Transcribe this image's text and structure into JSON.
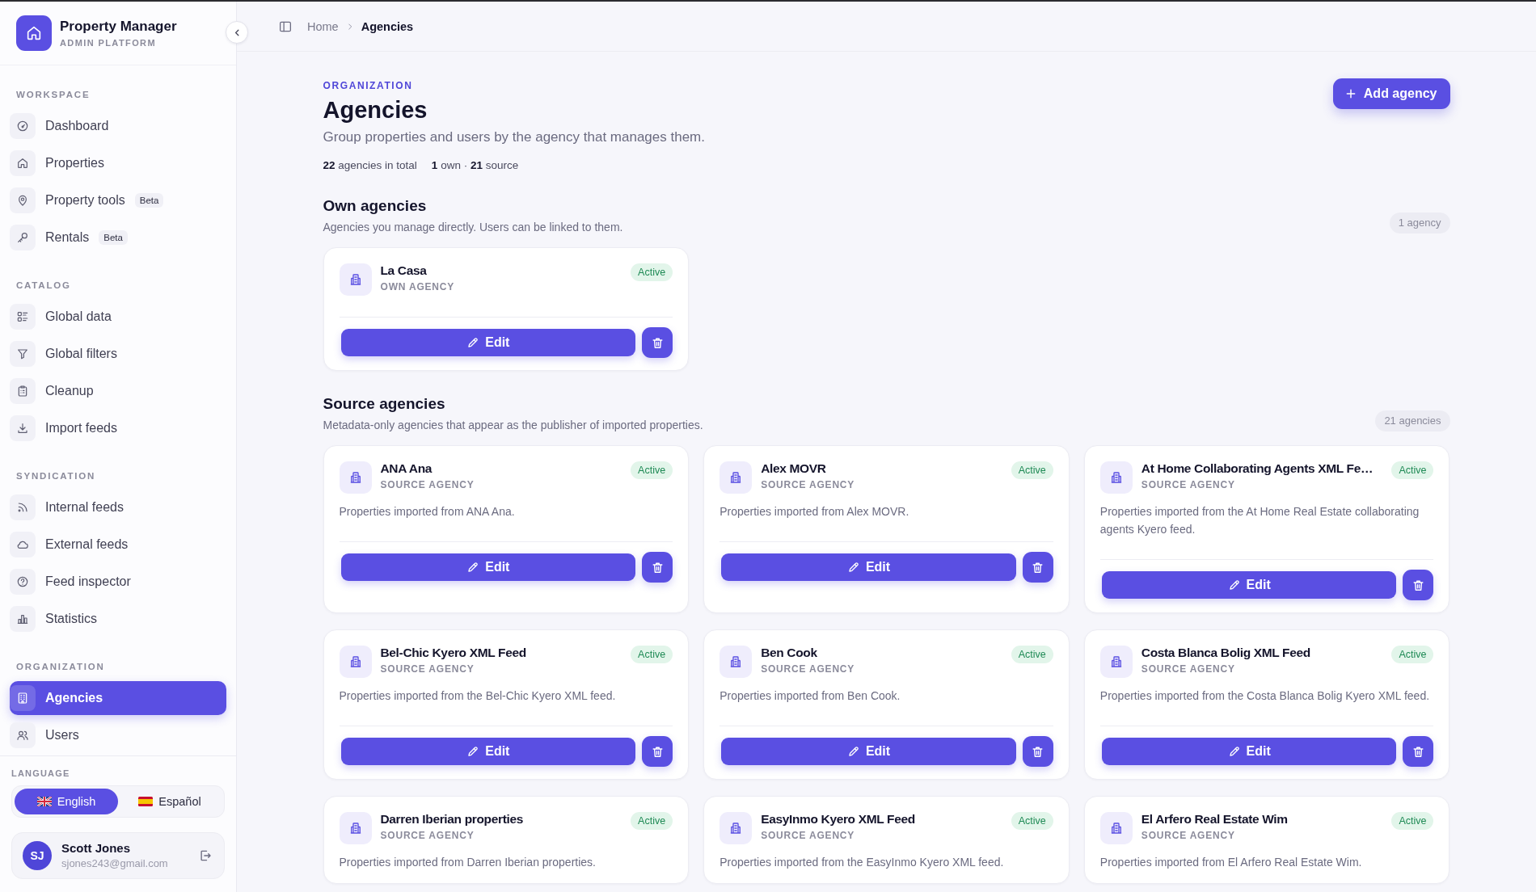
{
  "sidebar": {
    "brand": {
      "title": "Property Manager",
      "subtitle": "ADMIN PLATFORM"
    },
    "sections": [
      {
        "label": "WORKSPACE",
        "items": [
          {
            "label": "Dashboard",
            "selected": false
          },
          {
            "label": "Properties",
            "selected": false
          },
          {
            "label": "Property tools",
            "badge": "Beta",
            "selected": false
          },
          {
            "label": "Rentals",
            "badge": "Beta",
            "selected": false
          }
        ]
      },
      {
        "label": "CATALOG",
        "items": [
          {
            "label": "Global data",
            "selected": false
          },
          {
            "label": "Global filters",
            "selected": false
          },
          {
            "label": "Cleanup",
            "selected": false
          },
          {
            "label": "Import feeds",
            "selected": false
          }
        ]
      },
      {
        "label": "SYNDICATION",
        "items": [
          {
            "label": "Internal feeds",
            "selected": false
          },
          {
            "label": "External feeds",
            "selected": false
          },
          {
            "label": "Feed inspector",
            "selected": false
          },
          {
            "label": "Statistics",
            "selected": false
          }
        ]
      },
      {
        "label": "ORGANIZATION",
        "items": [
          {
            "label": "Agencies",
            "selected": true
          },
          {
            "label": "Users",
            "selected": false
          }
        ]
      }
    ],
    "language": {
      "label": "LANGUAGE",
      "options": [
        {
          "label": "English",
          "selected": true
        },
        {
          "label": "Español",
          "selected": false
        }
      ]
    },
    "user": {
      "initials": "SJ",
      "name": "Scott Jones",
      "email": "sjones243@gmail.com"
    }
  },
  "topbar": {
    "breadcrumb": [
      {
        "label": "Home",
        "current": false
      },
      {
        "label": "Agencies",
        "current": true
      }
    ]
  },
  "page": {
    "eyebrow": "ORGANIZATION",
    "title": "Agencies",
    "subtitle": "Group properties and users by the agency that manages them.",
    "stats": [
      "**22** agencies in total",
      "**1** own · **21** source"
    ],
    "action": "Add agency",
    "sections": [
      {
        "title": "Own agencies",
        "description": "Agencies you manage directly. Users can be linked to them.",
        "count": "1 agency",
        "agencies": [
          {
            "name": "La Casa",
            "type": "OWN AGENCY",
            "status": "Active",
            "edit_label": "Edit"
          }
        ]
      },
      {
        "title": "Source agencies",
        "description": "Metadata-only agencies that appear as the publisher of imported properties.",
        "count": "21 agencies",
        "agencies": [
          {
            "name": "ANA Ana",
            "type": "SOURCE AGENCY",
            "status": "Active",
            "description": "Properties imported from ANA Ana.",
            "edit_label": "Edit"
          },
          {
            "name": "Alex MOVR",
            "type": "SOURCE AGENCY",
            "status": "Active",
            "description": "Properties imported from Alex MOVR.",
            "edit_label": "Edit"
          },
          {
            "name": "At Home Collaborating Agents XML Fe…",
            "type": "SOURCE AGENCY",
            "status": "Active",
            "description": "Properties imported from the At Home Real Estate collaborating agents Kyero feed.",
            "edit_label": "Edit"
          },
          {
            "name": "Bel-Chic Kyero XML Feed",
            "type": "SOURCE AGENCY",
            "status": "Active",
            "description": "Properties imported from the Bel-Chic Kyero XML feed.",
            "edit_label": "Edit"
          },
          {
            "name": "Ben Cook",
            "type": "SOURCE AGENCY",
            "status": "Active",
            "description": "Properties imported from Ben Cook.",
            "edit_label": "Edit"
          },
          {
            "name": "Costa Blanca Bolig XML Feed",
            "type": "SOURCE AGENCY",
            "status": "Active",
            "description": "Properties imported from the Costa Blanca Bolig Kyero XML feed.",
            "edit_label": "Edit"
          },
          {
            "name": "Darren Iberian properties",
            "type": "SOURCE AGENCY",
            "status": "Active",
            "description": "Properties imported from Darren Iberian properties."
          },
          {
            "name": "EasyInmo Kyero XML Feed",
            "type": "SOURCE AGENCY",
            "status": "Active",
            "description": "Properties imported from the EasyInmo Kyero XML feed."
          },
          {
            "name": "El Arfero Real Estate Wim",
            "type": "SOURCE AGENCY",
            "status": "Active",
            "description": "Properties imported from El Arfero Real Estate Wim."
          }
        ]
      }
    ]
  }
}
